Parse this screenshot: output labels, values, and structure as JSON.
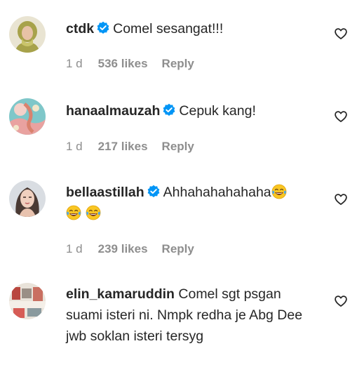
{
  "colors": {
    "text": "#262626",
    "secondary_text": "#8e8e8e",
    "verified_badge": "#0095f6"
  },
  "comments": [
    {
      "username": "ctdk",
      "verified": true,
      "text": "Comel sesangat!!!",
      "time": "1 d",
      "likes": "536 likes",
      "reply": "Reply"
    },
    {
      "username": "hanaalmauzah",
      "verified": true,
      "text": "Cepuk kang!",
      "time": "1 d",
      "likes": "217 likes",
      "reply": "Reply"
    },
    {
      "username": "bellaastillah",
      "verified": true,
      "text": "Ahhahahahahaha",
      "emoji": "😂",
      "time": "1 d",
      "likes": "239 likes",
      "reply": "Reply"
    },
    {
      "username": "elin_kamaruddin",
      "verified": false,
      "text": "Comel sgt psgan suami isteri ni. Nmpk redha je Abg Dee jwb soklan isteri tersyg"
    }
  ],
  "icons": {
    "verified": "verified-badge-icon",
    "like": "heart-outline-icon",
    "emoji": "face-with-tears-of-joy-icon"
  }
}
